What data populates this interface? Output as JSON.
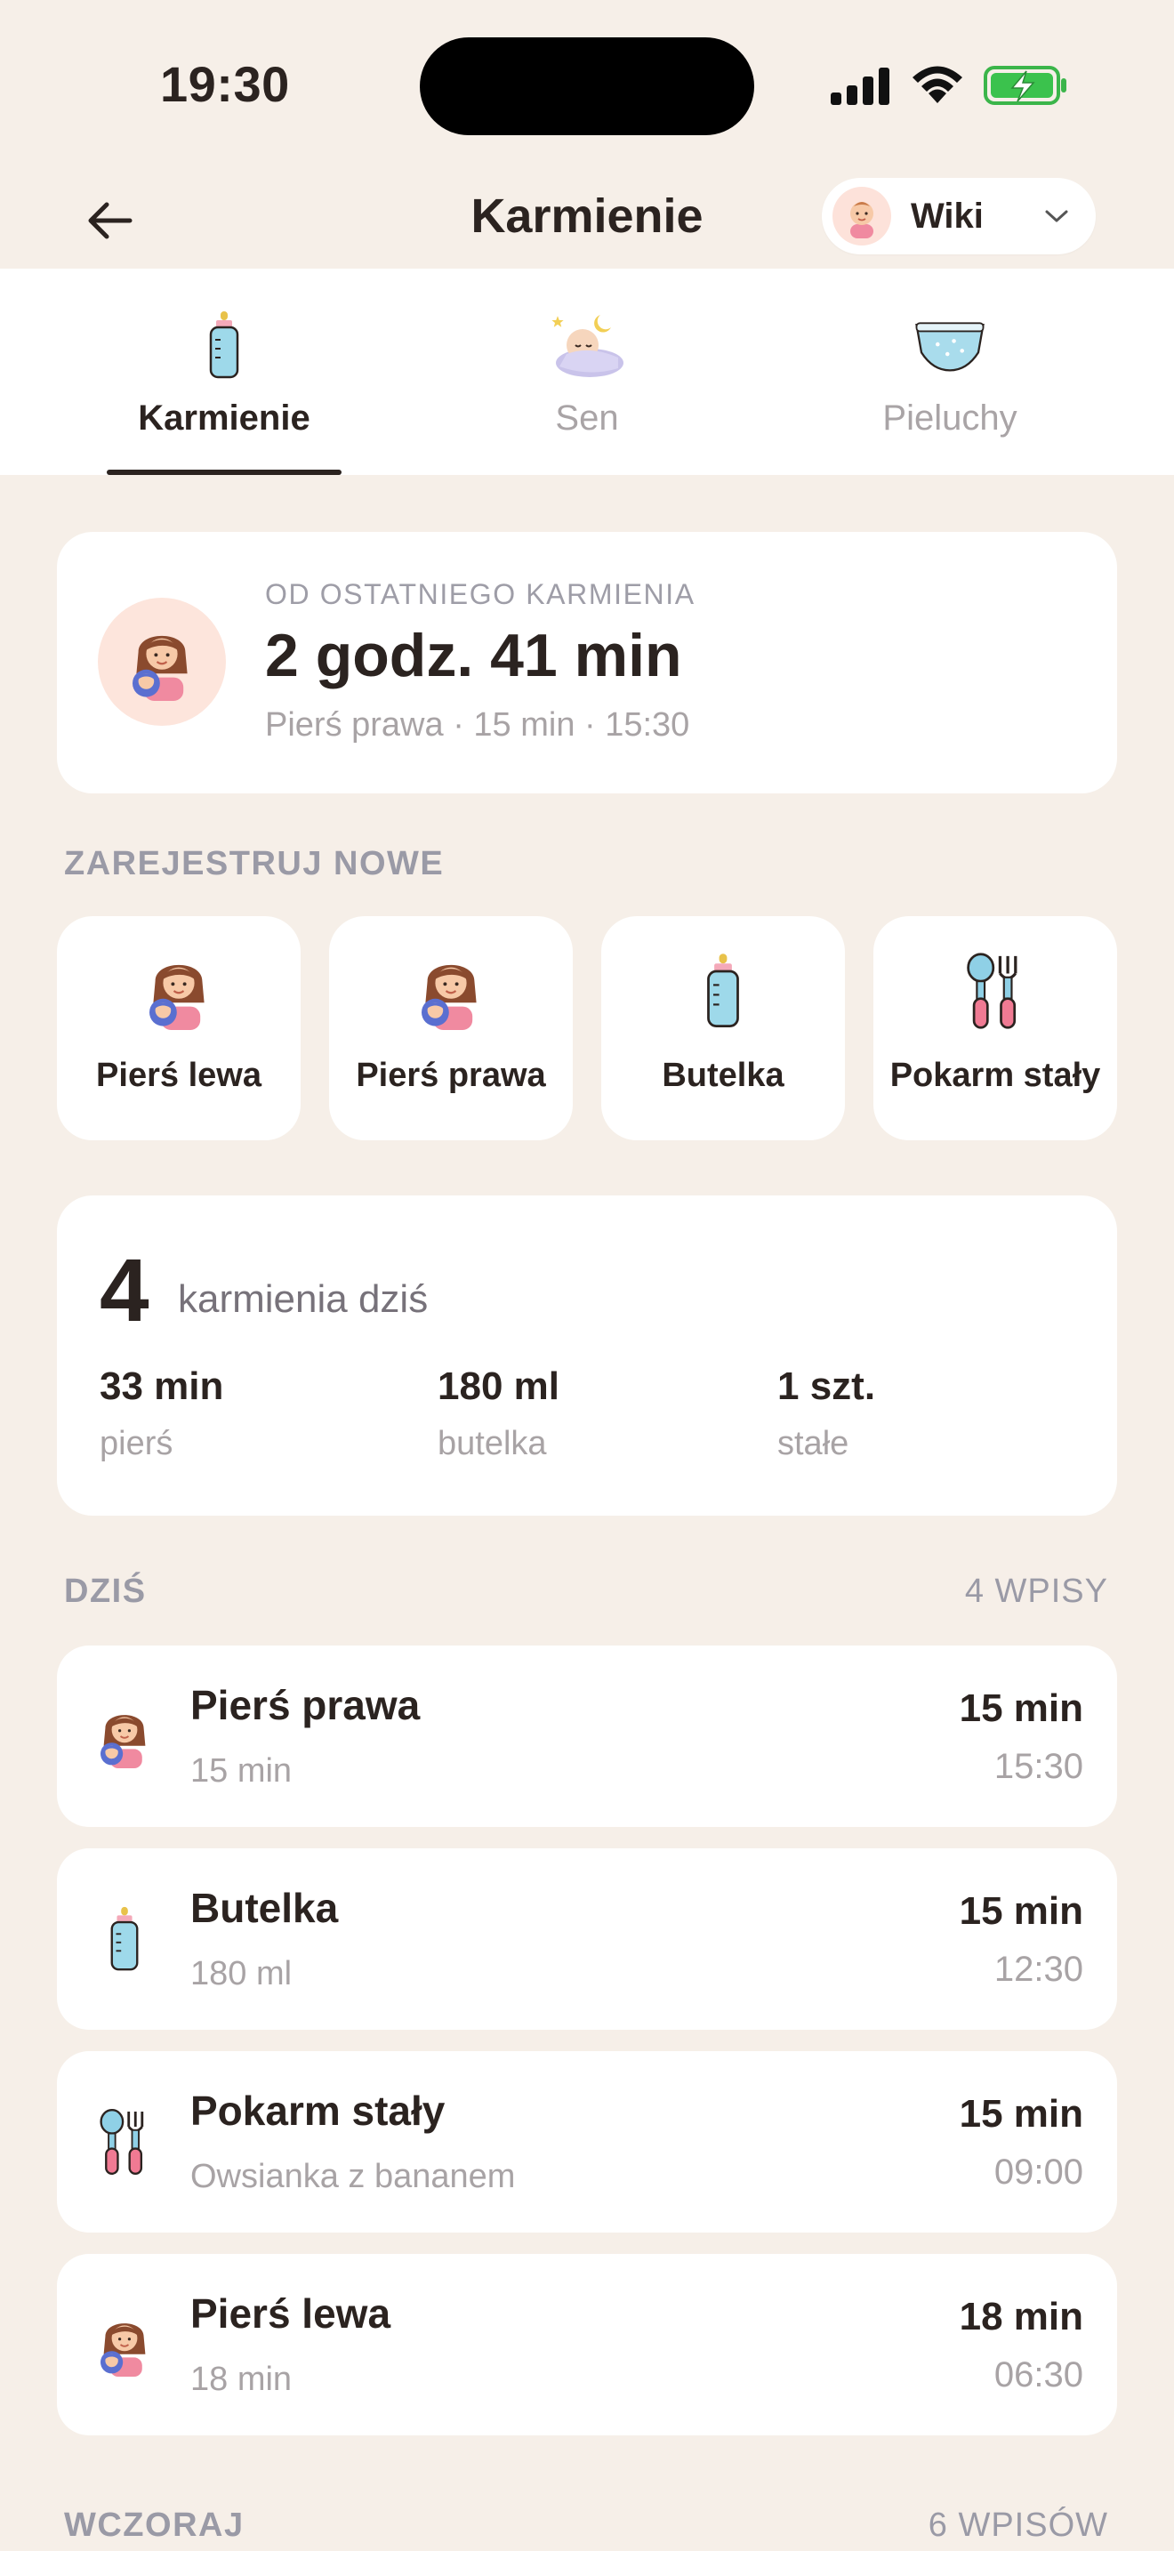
{
  "status_bar": {
    "time": "19:30"
  },
  "header": {
    "title": "Karmienie",
    "profile_name": "Wiki"
  },
  "tabs": [
    {
      "label": "Karmienie",
      "icon": "bottle-icon",
      "active": true
    },
    {
      "label": "Sen",
      "icon": "sleeping-baby-icon",
      "active": false
    },
    {
      "label": "Pieluchy",
      "icon": "diaper-icon",
      "active": false
    }
  ],
  "last_feeding": {
    "eyebrow": "OD OSTATNIEGO KARMIENIA",
    "value": "2 godz. 41 min",
    "detail": "Pierś prawa · 15 min · 15:30"
  },
  "register": {
    "label": "ZAREJESTRUJ NOWE",
    "buttons": [
      {
        "label": "Pierś lewa",
        "icon": "breastfeeding-icon"
      },
      {
        "label": "Pierś prawa",
        "icon": "breastfeeding-icon"
      },
      {
        "label": "Butelka",
        "icon": "bottle-icon"
      },
      {
        "label": "Pokarm stały",
        "icon": "spoon-fork-icon"
      }
    ]
  },
  "summary": {
    "count": "4",
    "count_label": "karmienia dziś",
    "stats": [
      {
        "value": "33 min",
        "label": "pierś"
      },
      {
        "value": "180 ml",
        "label": "butelka"
      },
      {
        "value": "1 szt.",
        "label": "stałe"
      }
    ]
  },
  "today": {
    "label": "DZIŚ",
    "count": "4 WPISY",
    "entries": [
      {
        "title": "Pierś prawa",
        "subtitle": "15 min",
        "duration": "15 min",
        "time": "15:30",
        "icon": "breastfeeding-icon"
      },
      {
        "title": "Butelka",
        "subtitle": "180 ml",
        "duration": "15 min",
        "time": "12:30",
        "icon": "bottle-icon"
      },
      {
        "title": "Pokarm stały",
        "subtitle": "Owsianka z bananem",
        "duration": "15 min",
        "time": "09:00",
        "icon": "spoon-fork-icon"
      },
      {
        "title": "Pierś lewa",
        "subtitle": "18 min",
        "duration": "18 min",
        "time": "06:30",
        "icon": "breastfeeding-icon"
      }
    ]
  },
  "yesterday": {
    "label": "WCZORAJ",
    "count": "6 WPISÓW"
  },
  "colors": {
    "background": "#f6efe8",
    "card": "#ffffff",
    "text": "#2b2320",
    "muted": "#a8a3a5",
    "accent_pink": "#fde5dc"
  }
}
